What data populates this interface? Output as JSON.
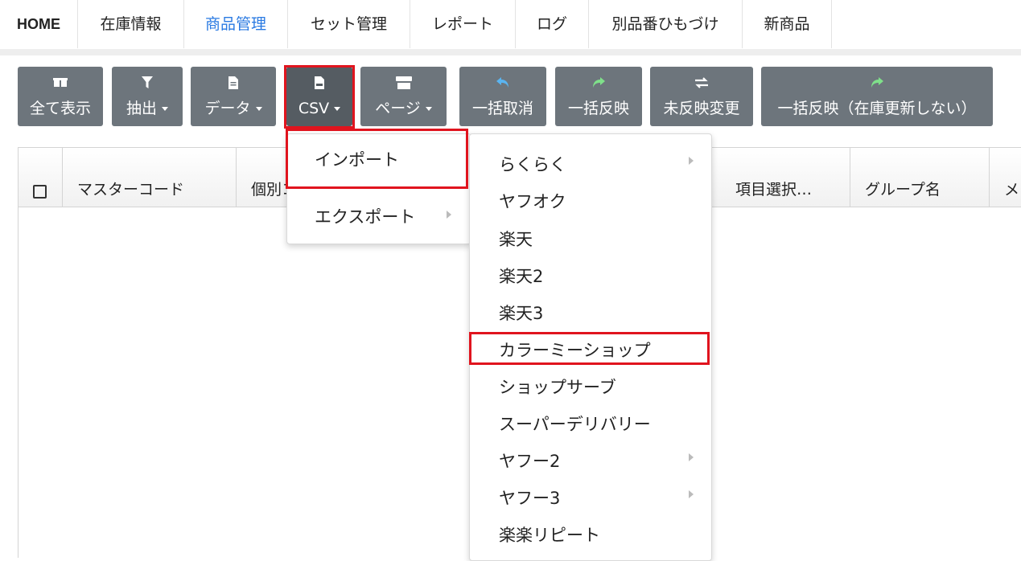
{
  "nav": {
    "tabs": [
      {
        "label": "HOME"
      },
      {
        "label": "在庫情報"
      },
      {
        "label": "商品管理"
      },
      {
        "label": "セット管理"
      },
      {
        "label": "レポート"
      },
      {
        "label": "ログ"
      },
      {
        "label": "別品番ひもづけ"
      },
      {
        "label": "新商品"
      }
    ],
    "active": "商品管理"
  },
  "toolbar": {
    "show_all": "全て表示",
    "extract": "抽出",
    "data": "データ",
    "csv": "CSV",
    "page": "ページ",
    "bulk_cancel": "一括取消",
    "bulk_apply": "一括反映",
    "unapplied_changes": "未反映変更",
    "bulk_apply_no_stock": "一括反映（在庫更新しない）"
  },
  "table": {
    "columns": [
      "マスターコード",
      "個別コ",
      "項目選択…",
      "グループ名",
      "メ"
    ]
  },
  "csv_menu": {
    "items": [
      {
        "label": "インポート",
        "has_submenu": false
      },
      {
        "label": "エクスポート",
        "has_submenu": true
      }
    ]
  },
  "import_menu": {
    "items": [
      {
        "label": "らくらく",
        "has_submenu": true
      },
      {
        "label": "ヤフオク",
        "has_submenu": false
      },
      {
        "label": "楽天",
        "has_submenu": false
      },
      {
        "label": "楽天2",
        "has_submenu": false
      },
      {
        "label": "楽天3",
        "has_submenu": false
      },
      {
        "label": "カラーミーショップ",
        "has_submenu": false
      },
      {
        "label": "ショップサーブ",
        "has_submenu": false
      },
      {
        "label": "スーパーデリバリー",
        "has_submenu": false
      },
      {
        "label": "ヤフー2",
        "has_submenu": true
      },
      {
        "label": "ヤフー3",
        "has_submenu": true
      },
      {
        "label": "楽楽リピート",
        "has_submenu": false
      }
    ]
  },
  "icons": {
    "show_all": "boxes-icon",
    "extract": "filter-icon",
    "data": "file-icon",
    "csv": "csv-file-icon",
    "page": "store-icon",
    "bulk_cancel": "undo-arrow-icon",
    "bulk_apply": "redo-arrow-icon",
    "unapplied_changes": "exchange-icon"
  },
  "colors": {
    "button_bg": "#6d757c",
    "active_tab": "#2a7ae2",
    "highlight_border": "#e0141e",
    "undo_icon": "#5ab4f0",
    "redo_icon": "#7fe08a"
  }
}
